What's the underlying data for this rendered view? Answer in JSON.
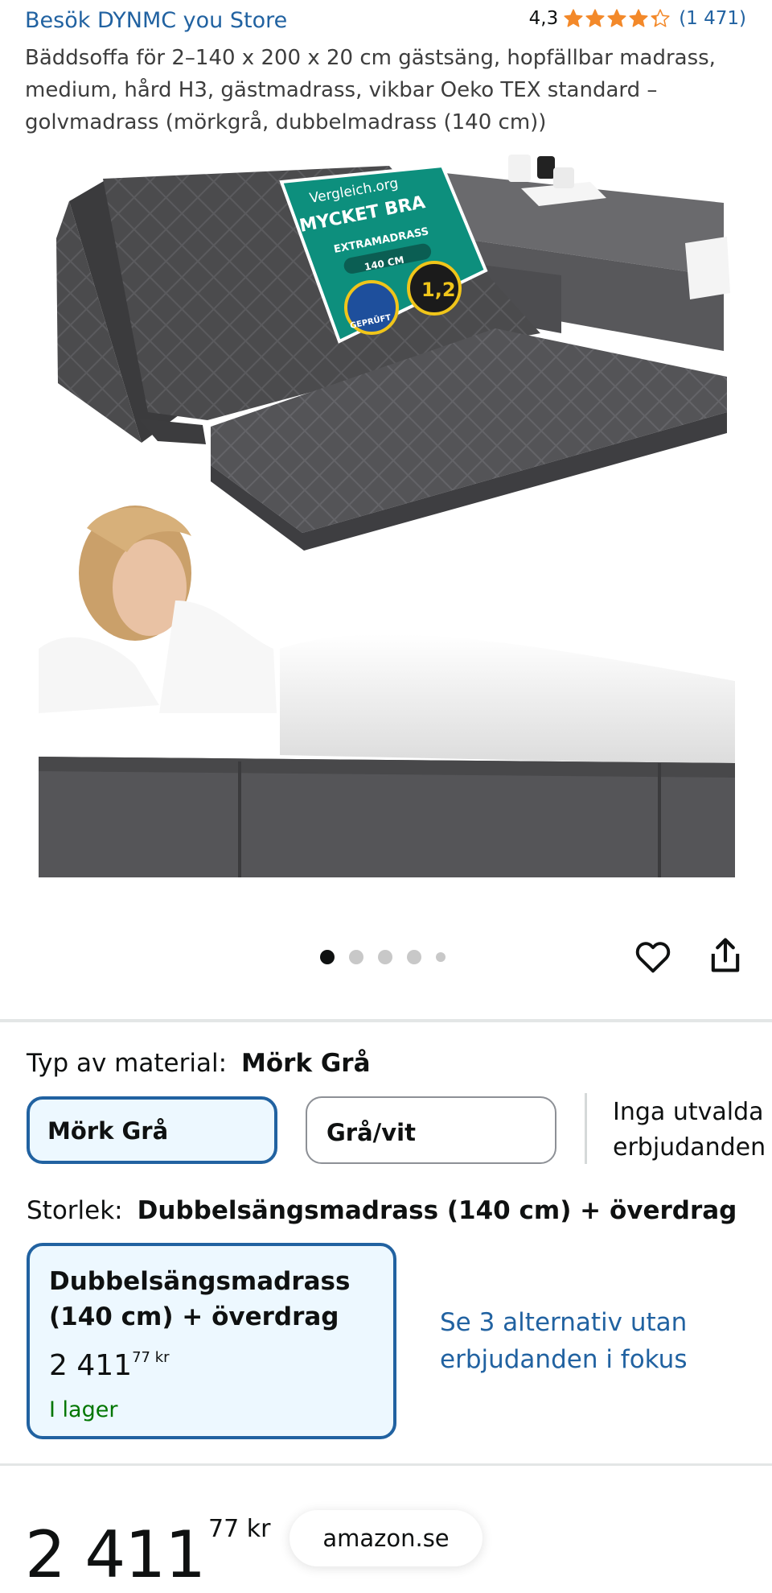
{
  "header": {
    "store_link": "Besök DYNMC you Store",
    "rating_value": "4,3",
    "rating_stars": 4.3,
    "rating_count": "(1 471)",
    "title": "Bäddsoffa för 2–140 x 200 x 20 cm gästsäng, hopfällbar madrass, medium, hård H3, gästmadrass, vikbar Oeko TEX standard – golvmadrass (mörkgrå, dubbelmadrass (140 cm))"
  },
  "image": {
    "badge_brand": "Vergleich.org",
    "badge_verdict": "MYCKET BRA",
    "badge_product": "EXTRAMADRASS",
    "badge_size": "140 CM",
    "badge_seal": "GEPRÜFT",
    "badge_score": "1,2",
    "carousel_count": 5,
    "carousel_active": 0
  },
  "material": {
    "label": "Typ av material:",
    "selected": "Mörk Grå",
    "options": [
      "Mörk Grå",
      "Grå/vit"
    ],
    "no_offers": "Inga utvalda erbjudanden"
  },
  "size": {
    "label": "Storlek:",
    "selected": "Dubbelsängsmadrass (140 cm) + överdrag",
    "card_name": "Dubbelsängsmadrass (140 cm) + överdrag",
    "card_price_whole": "2 411",
    "card_price_fraction": "77",
    "card_price_currency": "kr",
    "card_stock": "I lager",
    "alt_link": "Se 3 alternativ utan erbjudanden i fokus"
  },
  "buybox": {
    "price_whole": "2 411",
    "price_fraction": "77",
    "price_currency": "kr",
    "site": "amazon.se"
  },
  "colors": {
    "link": "#2162a1",
    "star": "#f3892a",
    "selected_border": "#2162a1",
    "selected_bg": "#edf8ff",
    "in_stock": "#007600"
  }
}
